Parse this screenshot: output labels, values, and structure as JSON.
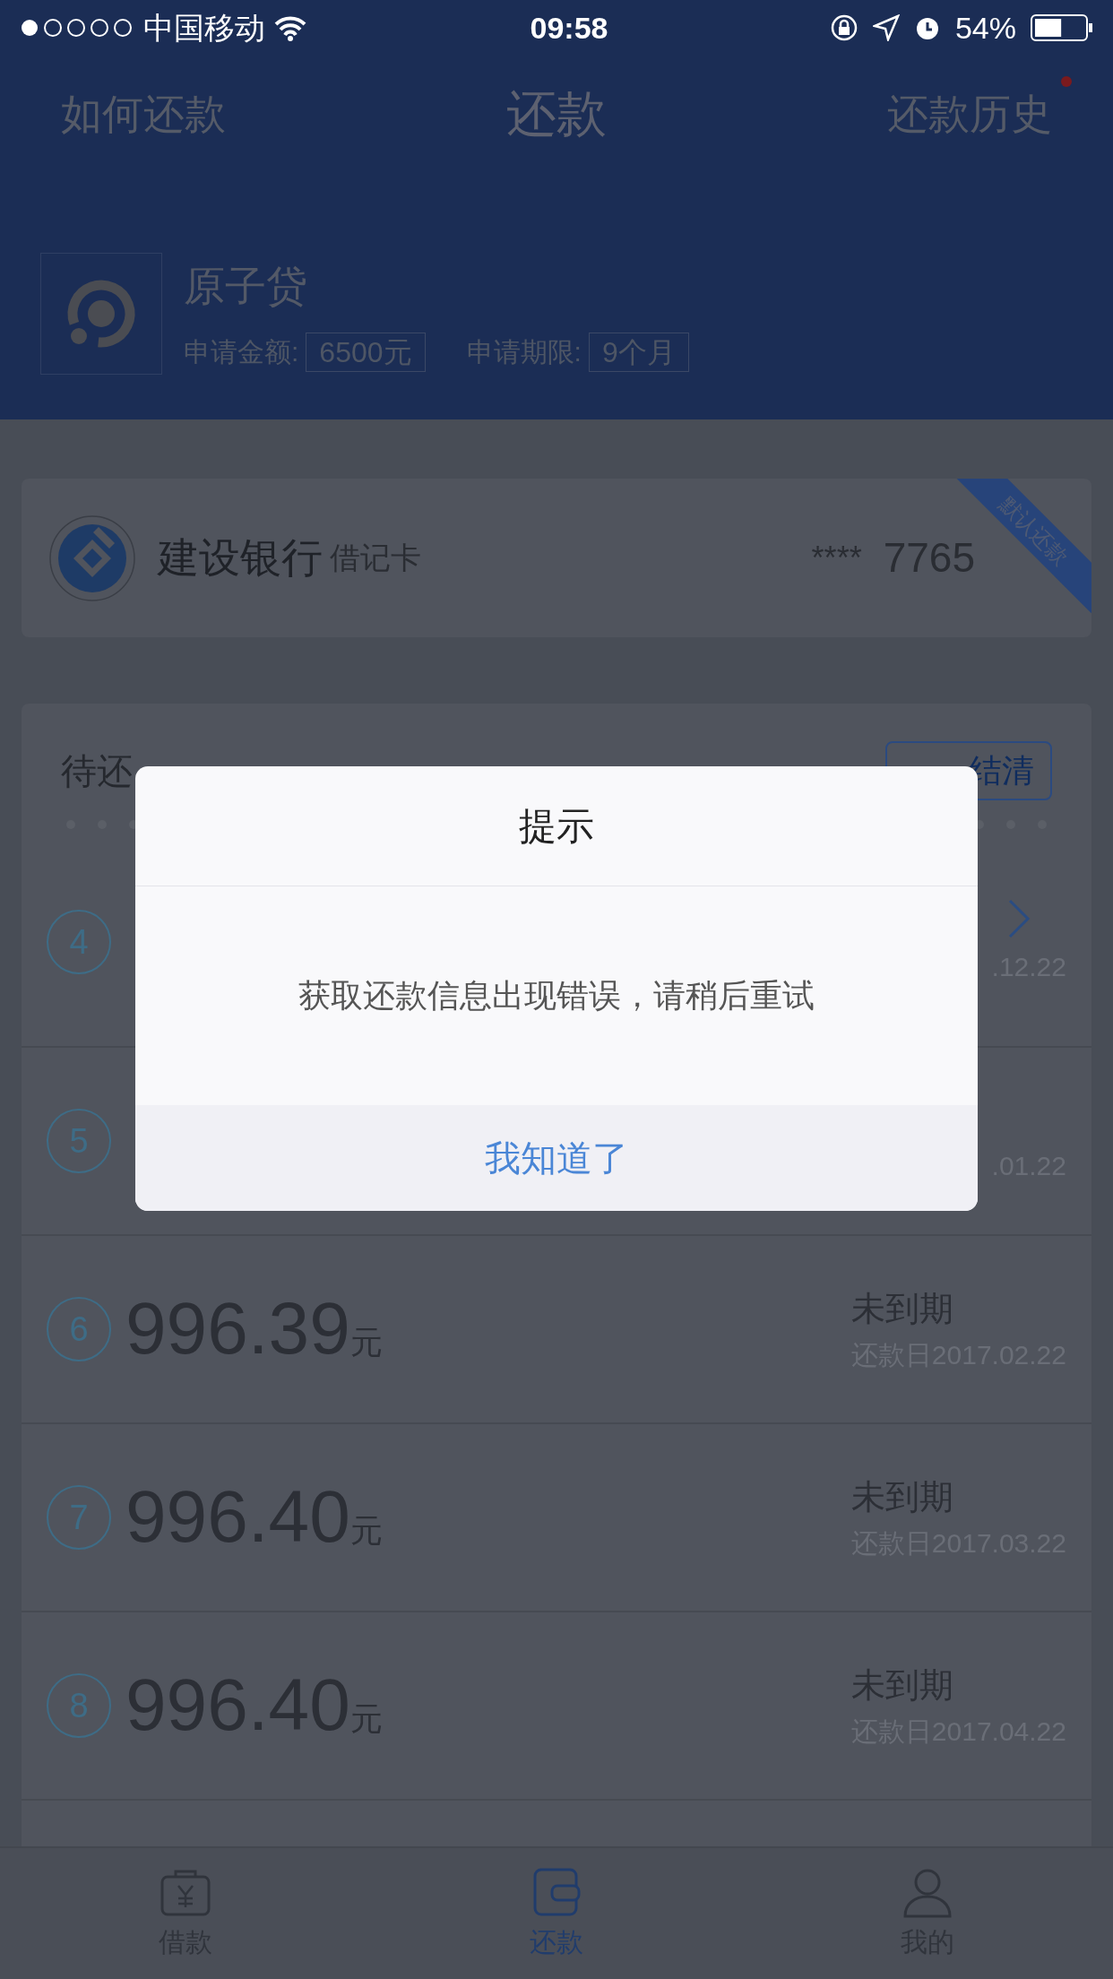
{
  "status_bar": {
    "carrier": "中国移动",
    "time": "09:58",
    "battery": "54%"
  },
  "header": {
    "left_link": "如何还款",
    "title": "还款",
    "right_link": "还款历史",
    "has_new": true
  },
  "product": {
    "name": "原子贷",
    "amount_label": "申请金额:",
    "amount": "6500元",
    "term_label": "申请期限:",
    "term": "9个月"
  },
  "bank_card": {
    "bank": "建设银行",
    "card_type": "借记卡",
    "mask": "****",
    "last4": "7765",
    "ribbon": "默认还款"
  },
  "bills": {
    "title": "待还",
    "action": "结清",
    "rows": [
      {
        "kind": "covered",
        "number": "4",
        "date": ".12.22",
        "arrow": true
      },
      {
        "kind": "covered",
        "number": "5",
        "date": ".01.22",
        "arrow": false
      },
      {
        "kind": "full",
        "number": "6",
        "amount": "996.39",
        "unit": "元",
        "status": "未到期",
        "date": "还款日2017.02.22",
        "arrow": false
      },
      {
        "kind": "full",
        "number": "7",
        "amount": "996.40",
        "unit": "元",
        "status": "未到期",
        "date": "还款日2017.03.22",
        "arrow": false
      },
      {
        "kind": "full",
        "number": "8",
        "amount": "996.40",
        "unit": "元",
        "status": "未到期",
        "date": "还款日2017.04.22",
        "arrow": false
      },
      {
        "kind": "hidden",
        "arrow": false
      }
    ]
  },
  "dialog": {
    "title": "提示",
    "message": "获取还款信息出现错误，请稍后重试",
    "button": "我知道了"
  },
  "tab_bar": [
    {
      "label": "借款",
      "selected": false
    },
    {
      "label": "还款",
      "selected": true
    },
    {
      "label": "我的",
      "selected": false
    }
  ]
}
